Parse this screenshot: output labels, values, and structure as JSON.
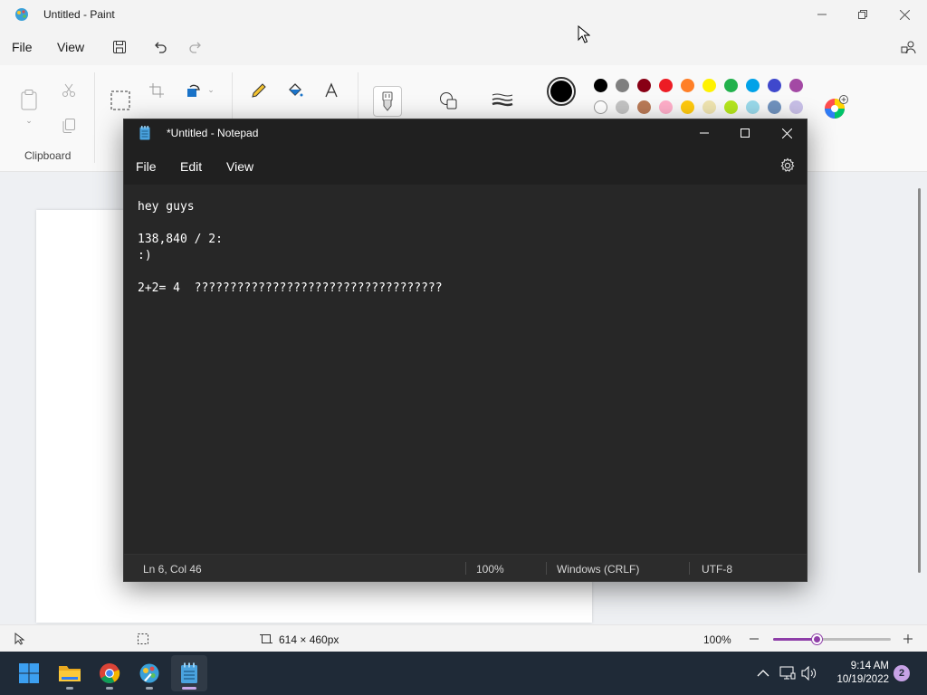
{
  "paint": {
    "title": "Untitled - Paint",
    "menu": {
      "file": "File",
      "view": "View"
    },
    "ribbon": {
      "clipboard_label": "Clipboard"
    },
    "colors": {
      "row1": [
        "#000000",
        "#7f7f7f",
        "#880015",
        "#ed1c24",
        "#ff7f27",
        "#fff200",
        "#22b14c",
        "#00a2e8",
        "#3f48cc",
        "#a349a4"
      ],
      "row2": [
        "#ffffff",
        "#c3c3c3",
        "#b97a57",
        "#ffaec9",
        "#ffc90e",
        "#efe4b0",
        "#b5e61d",
        "#99d9ea",
        "#7092be",
        "#c8bfe7"
      ],
      "primary": "#000000"
    },
    "status": {
      "canvas_size": "614 × 460px",
      "zoom": "100%",
      "zoom_fraction": 0.38
    }
  },
  "notepad": {
    "title": "*Untitled - Notepad",
    "menu": {
      "file": "File",
      "edit": "Edit",
      "view": "View"
    },
    "content": "hey guys\n\n138,840 / 2:\n:)\n\n2+2= 4  ???????????????????????????????????",
    "status": {
      "position": "Ln 6, Col 46",
      "zoom": "100%",
      "line_ending": "Windows (CRLF)",
      "encoding": "UTF-8"
    }
  },
  "taskbar": {
    "time": "9:14 AM",
    "date": "10/19/2022",
    "notifications": "2"
  }
}
